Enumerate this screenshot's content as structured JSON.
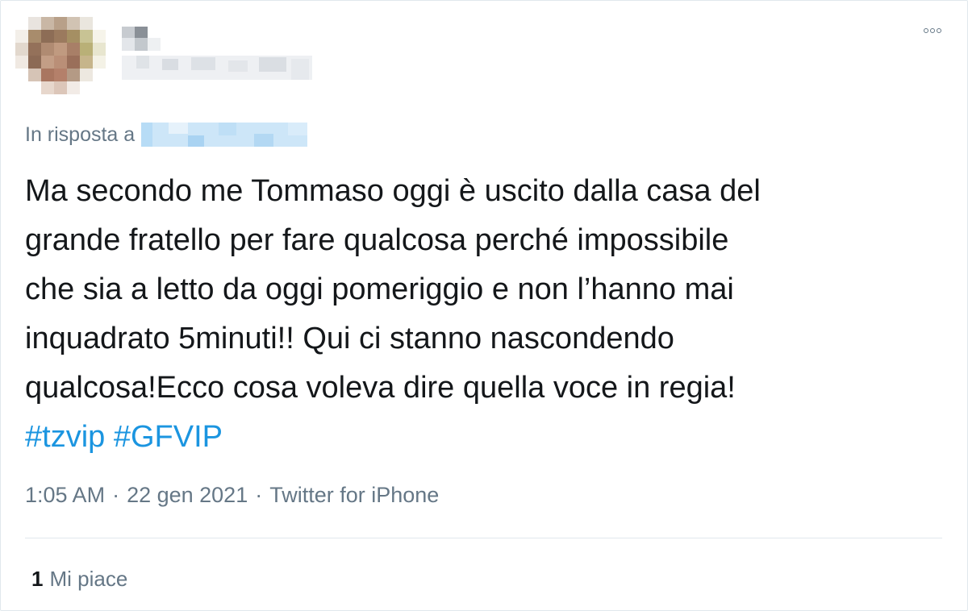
{
  "tweet": {
    "more_icon": "ellipsis-icon",
    "reply_prefix": "In risposta a",
    "text_lines": [
      "Ma secondo me Tommaso oggi è uscito dalla casa del",
      "grande fratello per fare qualcosa perché impossibile",
      "che sia a letto da oggi pomeriggio e non l’hanno mai",
      "inquadrato 5minuti!! Qui ci stanno nascondendo",
      "qualcosa!Ecco cosa voleva dire quella voce in regia!"
    ],
    "hashtags": [
      "#tzvip",
      "#GFVIP"
    ],
    "time": "1:05 AM",
    "date": "22 gen 2021",
    "separator": "·",
    "source": "Twitter for iPhone",
    "likes_count": "1",
    "likes_label": "Mi piace"
  },
  "colors": {
    "text": "#14171a",
    "secondary": "#657786",
    "link": "#1b95e0",
    "border": "#e1e8ed"
  }
}
